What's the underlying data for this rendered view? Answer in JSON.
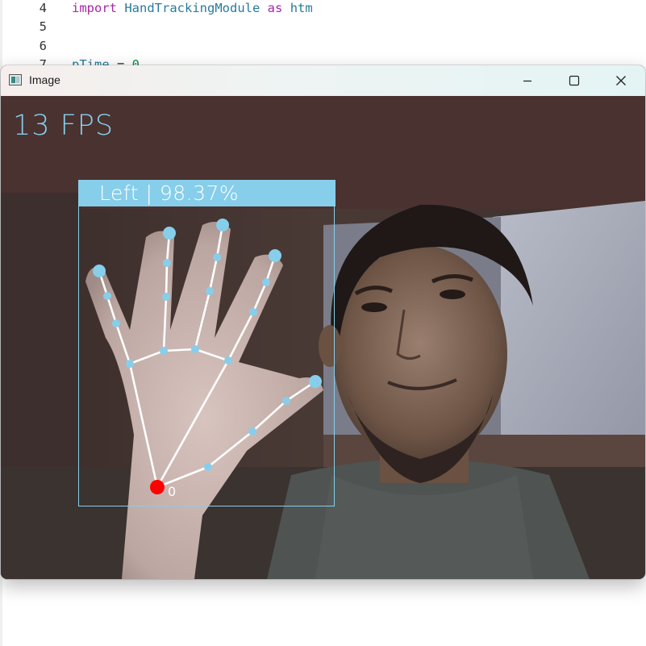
{
  "editor": {
    "lines": [
      {
        "number": "4",
        "tokens": [
          {
            "text": "import",
            "cls": "kw"
          },
          {
            "text": " ",
            "cls": "plain"
          },
          {
            "text": "HandTrackingModule",
            "cls": "mod"
          },
          {
            "text": " ",
            "cls": "plain"
          },
          {
            "text": "as",
            "cls": "kw"
          },
          {
            "text": " ",
            "cls": "plain"
          },
          {
            "text": "htm",
            "cls": "mod"
          }
        ]
      },
      {
        "number": "5",
        "tokens": []
      },
      {
        "number": "6",
        "tokens": []
      },
      {
        "number": "7",
        "tokens": [
          {
            "text": "pTime",
            "cls": "var"
          },
          {
            "text": " = ",
            "cls": "plain"
          },
          {
            "text": "0",
            "cls": "num"
          }
        ]
      }
    ]
  },
  "window": {
    "title": "Image",
    "icon": "app-window-icon",
    "controls": [
      "minimize-icon",
      "maximize-icon",
      "close-icon"
    ]
  },
  "overlay": {
    "fps_text": "13 FPS",
    "hand_label": "Left | 98.37%",
    "wrist_index": "0",
    "box_color": "#87ceeb",
    "landmark_color": "#87ceeb",
    "wrist_color": "#ff0000",
    "connection_color": "#ffffff"
  }
}
